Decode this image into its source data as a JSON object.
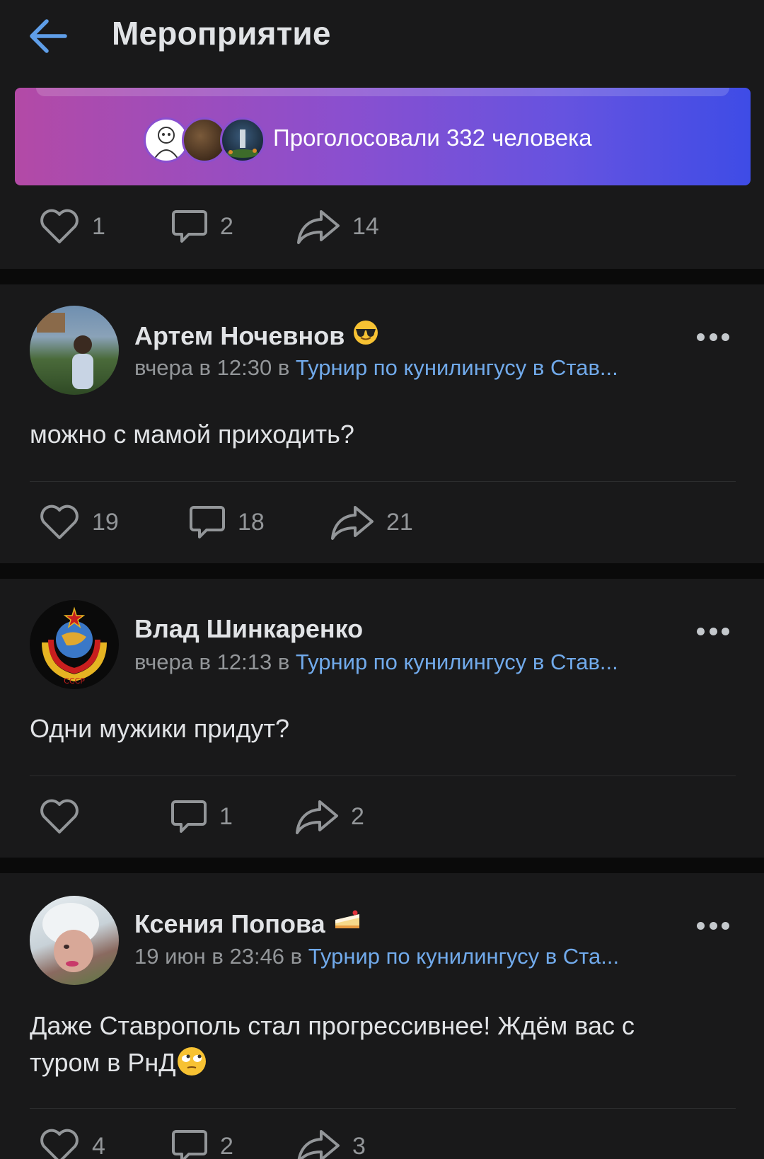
{
  "header": {
    "title": "Мероприятие"
  },
  "poll": {
    "voters_text": "Проголосовали 332 человека"
  },
  "post_actions": {
    "likes": "1",
    "comments": "2",
    "shares": "14"
  },
  "comments": [
    {
      "author": "Артем Ночевнов",
      "author_emoji": "sunglasses-emoji",
      "date": "вчера в 12:30 в ",
      "group": "Турнир по кунилингусу в Став...",
      "text": "можно с мамой приходить?",
      "likes": "19",
      "comments": "18",
      "shares": "21"
    },
    {
      "author": "Влад Шинкаренко",
      "date": "вчера в 12:13 в ",
      "group": "Турнир по кунилингусу в Став...",
      "avatar_text": "СССР",
      "text": "Одни мужики придут?",
      "likes": "",
      "comments": "1",
      "shares": "2"
    },
    {
      "author": "Ксения Попова",
      "author_emoji": "cake-emoji",
      "date": "19 июн в 23:46 в ",
      "group": "Турнир по кунилингусу в Ста...",
      "text": "Даже Ставрополь стал прогрессивнее! Ждём вас с туром в РнД",
      "text_emoji": "eye-roll-emoji",
      "likes": "4",
      "comments": "2",
      "shares": "3"
    }
  ],
  "colors": {
    "background": "#0a0a0a",
    "card": "#19191a",
    "link": "#71aaeb",
    "accent": "#5181b8",
    "muted": "#939699"
  }
}
